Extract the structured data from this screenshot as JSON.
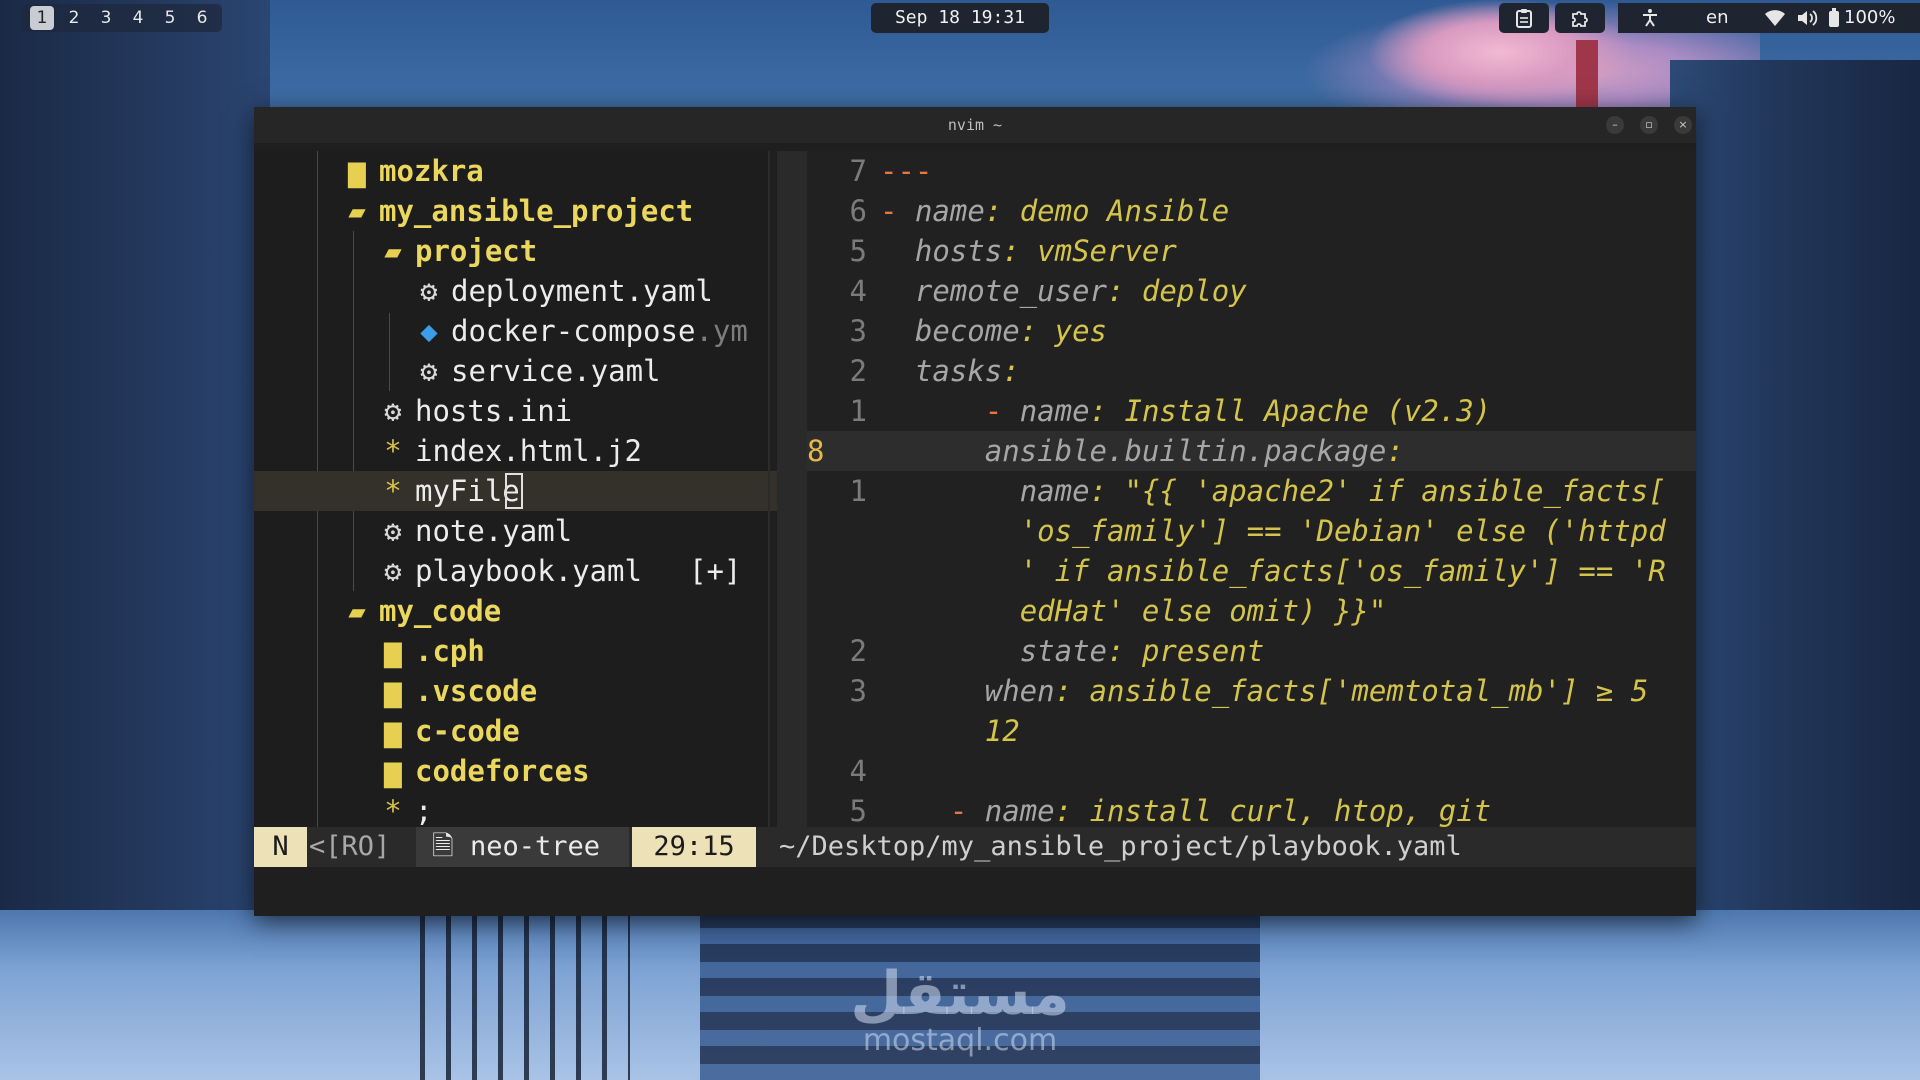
{
  "topbar": {
    "workspaces": [
      "1",
      "2",
      "3",
      "4",
      "5",
      "6"
    ],
    "active_workspace": "1",
    "clock": "Sep 18 19:31",
    "icons": [
      "clipboard-icon",
      "puzzle-icon",
      "accessibility-icon",
      "wifi-icon",
      "volume-icon",
      "battery-icon"
    ],
    "language": "en",
    "battery": "100%"
  },
  "window": {
    "title": "nvim ~",
    "controls": [
      "minimize-icon",
      "maximize-icon",
      "close-icon"
    ]
  },
  "tree": {
    "items": [
      {
        "name": "mozkra",
        "icon": "folder-icon",
        "glyph": "▆"
      },
      {
        "name": "my_ansible_project",
        "icon": "folder-open-icon",
        "glyph": "▰"
      },
      {
        "name": "project",
        "icon": "folder-open-icon",
        "glyph": "▰"
      },
      {
        "name": "deployment.yaml",
        "icon": "gear-icon",
        "glyph": "⚙"
      },
      {
        "name": "docker-compose",
        "dim": ".ym",
        "icon": "docker-icon",
        "glyph": "◆"
      },
      {
        "name": "service.yaml",
        "icon": "gear-icon",
        "glyph": "⚙"
      },
      {
        "name": "hosts.ini",
        "icon": "gear-icon",
        "glyph": "⚙"
      },
      {
        "name": "index.html.j2",
        "icon": "star-icon",
        "glyph": "*"
      },
      {
        "name": "myFile",
        "icon": "star-icon",
        "glyph": "*"
      },
      {
        "name": "note.yaml",
        "icon": "gear-icon",
        "glyph": "⚙"
      },
      {
        "name": "playbook.yaml",
        "modified": "[+]",
        "icon": "gear-icon",
        "glyph": "⚙"
      },
      {
        "name": "my_code",
        "icon": "folder-open-icon",
        "glyph": "▰"
      },
      {
        "name": ".cph",
        "icon": "folder-icon",
        "glyph": "▆"
      },
      {
        "name": ".vscode",
        "icon": "folder-icon",
        "glyph": "▆"
      },
      {
        "name": "c-code",
        "icon": "folder-icon",
        "glyph": "▆"
      },
      {
        "name": "codeforces",
        "icon": "folder-icon",
        "glyph": "▆"
      },
      {
        "name": ";",
        "icon": "star-icon",
        "glyph": "*"
      }
    ]
  },
  "editor": {
    "current_line_number": "8",
    "lines": [
      {
        "n": "7",
        "dash": "---",
        "key": "",
        "val": ""
      },
      {
        "n": "6",
        "dash": "-",
        "key": "name",
        "val": "demo Ansible"
      },
      {
        "n": "5",
        "dash": "",
        "key": "hosts",
        "val": "vmServer"
      },
      {
        "n": "4",
        "dash": "",
        "key": "remote_user",
        "val": "deploy"
      },
      {
        "n": "3",
        "dash": "",
        "key": "become",
        "val": "yes"
      },
      {
        "n": "2",
        "dash": "",
        "key": "tasks",
        "val": ""
      },
      {
        "n": "1",
        "dash": "-",
        "key": "name",
        "val": "Install Apache (v2.3)"
      },
      {
        "n": "8",
        "dash": "",
        "key": "ansible.builtin.package",
        "val": ""
      },
      {
        "n": "1",
        "dash": "",
        "key": "name",
        "val": "\"{{ 'apache2' if ansible_facts["
      },
      {
        "n": "",
        "dash": "",
        "key": "",
        "val": "'os_family'] == 'Debian' else ('httpd"
      },
      {
        "n": "",
        "dash": "",
        "key": "",
        "val": "' if ansible_facts['os_family'] == 'R"
      },
      {
        "n": "",
        "dash": "",
        "key": "",
        "val": "edHat' else omit) }}\""
      },
      {
        "n": "2",
        "dash": "",
        "key": "state",
        "val": "present"
      },
      {
        "n": "3",
        "dash": "",
        "key": "when",
        "val": "ansible_facts['memtotal_mb'] ≥ 5"
      },
      {
        "n": "",
        "dash": "",
        "key": "",
        "val": "12"
      },
      {
        "n": "4",
        "dash": "",
        "key": "",
        "val": ""
      },
      {
        "n": "5",
        "dash": "-",
        "key": "name",
        "val": "install curl, htop, git"
      }
    ]
  },
  "statusline": {
    "mode": "N",
    "readonly": "<[RO]",
    "buffer_icon": "file-icon",
    "buffer": "neo-tree",
    "position": "29:15",
    "path": "~/Desktop/my_ansible_project/playbook.yaml"
  },
  "watermark": {
    "arabic": "مستقل",
    "latin": "mostaql.com"
  }
}
